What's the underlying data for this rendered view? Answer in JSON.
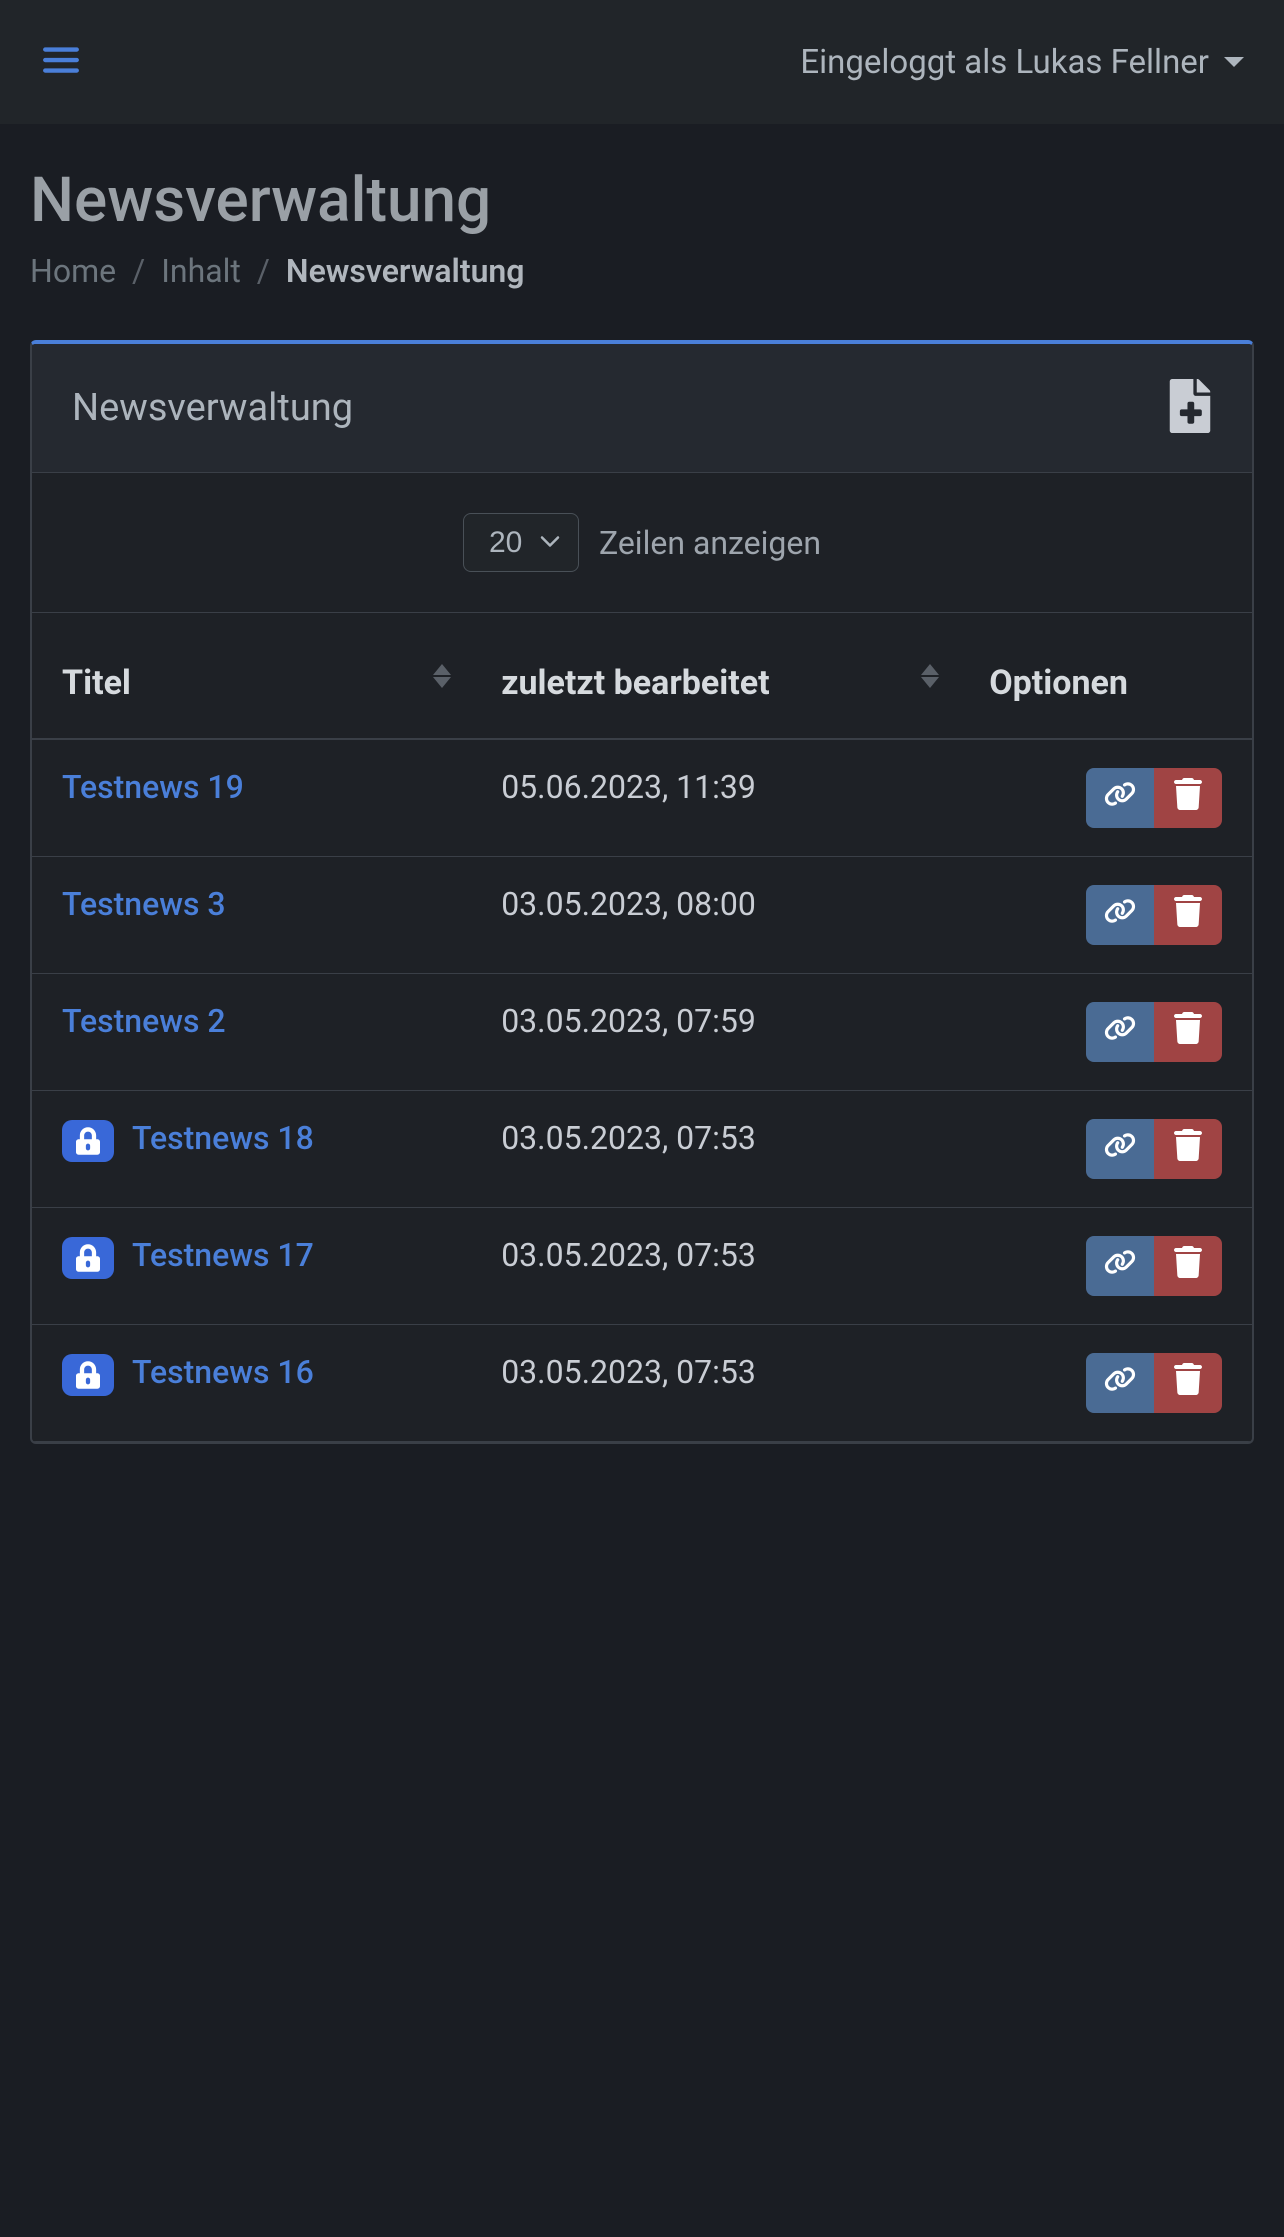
{
  "navbar": {
    "user_label": "Eingeloggt als Lukas Fellner"
  },
  "page": {
    "title": "Newsverwaltung"
  },
  "breadcrumb": {
    "home": "Home",
    "section": "Inhalt",
    "current": "Newsverwaltung"
  },
  "card": {
    "title": "Newsverwaltung",
    "rows_label": "Zeilen anzeigen",
    "rows_value": "20"
  },
  "table": {
    "columns": {
      "title": "Titel",
      "modified": "zuletzt bearbeitet",
      "options": "Optionen"
    },
    "rows": [
      {
        "title": "Testnews 19",
        "locked": false,
        "modified": "05.06.2023, 11:39"
      },
      {
        "title": "Testnews 3",
        "locked": false,
        "modified": "03.05.2023, 08:00"
      },
      {
        "title": "Testnews 2",
        "locked": false,
        "modified": "03.05.2023, 07:59"
      },
      {
        "title": "Testnews 18",
        "locked": true,
        "modified": "03.05.2023, 07:53"
      },
      {
        "title": "Testnews 17",
        "locked": true,
        "modified": "03.05.2023, 07:53"
      },
      {
        "title": "Testnews 16",
        "locked": true,
        "modified": "03.05.2023, 07:53"
      }
    ]
  }
}
